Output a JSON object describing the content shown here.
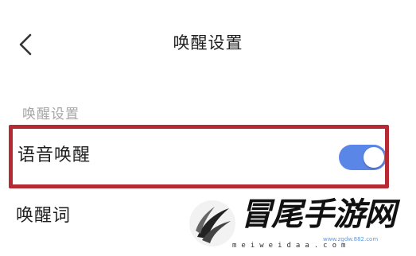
{
  "header": {
    "title": "唤醒设置",
    "back_icon": "chevron-left-icon"
  },
  "section": {
    "title": "唤醒设置"
  },
  "rows": {
    "voice_wake": {
      "label": "语音唤醒",
      "toggle_on": true
    },
    "wake_word": {
      "label": "唤醒词"
    }
  },
  "watermark": {
    "text": "冒尾手游网",
    "url": "meiweidaa.com",
    "url_secondary": "www.zgdw.882.com"
  },
  "colors": {
    "toggle_on": "#5a86e7",
    "highlight_border": "#b52a33",
    "section_header": "#a6a6a6",
    "text_primary": "#1f1f1f"
  }
}
